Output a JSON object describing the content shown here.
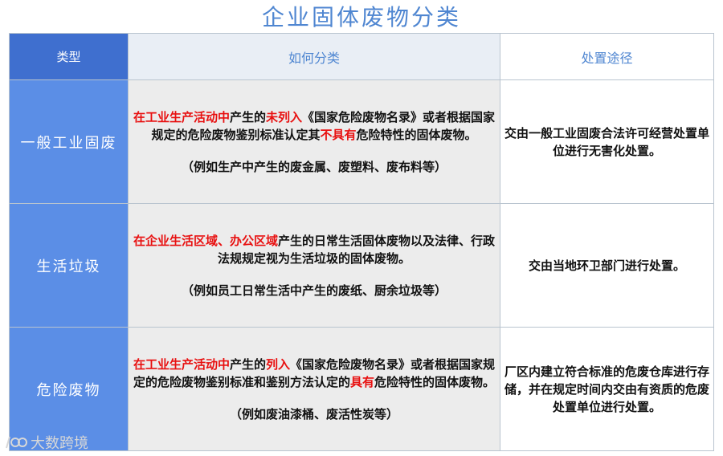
{
  "title": "企业固体废物分类",
  "headers": {
    "type": "类型",
    "how": "如何分类",
    "disposal": "处置途径"
  },
  "rows": [
    {
      "type": "一般工业固废",
      "how": {
        "p1": "在工业生产活动中",
        "p2": "产生的",
        "p3": "未列入",
        "p4": "《国家危险废物名录》或者根据国家规定的危险废物鉴别标准认定其",
        "p5": "不具有",
        "p6": "危险特性的固体废物。",
        "example": "（例如生产中产生的废金属、废塑料、废布料等）"
      },
      "disposal": "交由一般工业固废合法许可经营处置单位进行无害化处置。"
    },
    {
      "type": "生活垃圾",
      "how": {
        "p1": "在企业生活区域、办公区域",
        "p2": "产生的日常生活固体废物以及法律、行政法规规定视为生活垃圾的固体废物。",
        "example": "（例如员工日常生活中产生的废纸、厨余垃圾等）"
      },
      "disposal": "交由当地环卫部门进行处置。"
    },
    {
      "type": "危险废物",
      "how": {
        "p1": "在工业生产活动中",
        "p2": "产生的",
        "p3": "列入",
        "p4": "《国家危险废物名录》或者根据国家规定的危险废物鉴别标准和鉴别方法认定的",
        "p5": "具有",
        "p6": "危险特性的固体废物。",
        "example": "（例如废油漆桶、废活性炭等）"
      },
      "disposal": "厂区内建立符合标准的危废仓库进行存储，并在规定时间内交由有资质的危废处置单位进行处置。"
    }
  ],
  "watermark": {
    "logo_icon": "100-logo-icon",
    "text": "大数跨境"
  },
  "colors": {
    "title": "#4f86d1",
    "type_header_bg": "#3f6fcf",
    "type_cell_bg": "#5b8ee6",
    "how_cell_bg": "#ececec",
    "highlight_red": "#e81010"
  }
}
